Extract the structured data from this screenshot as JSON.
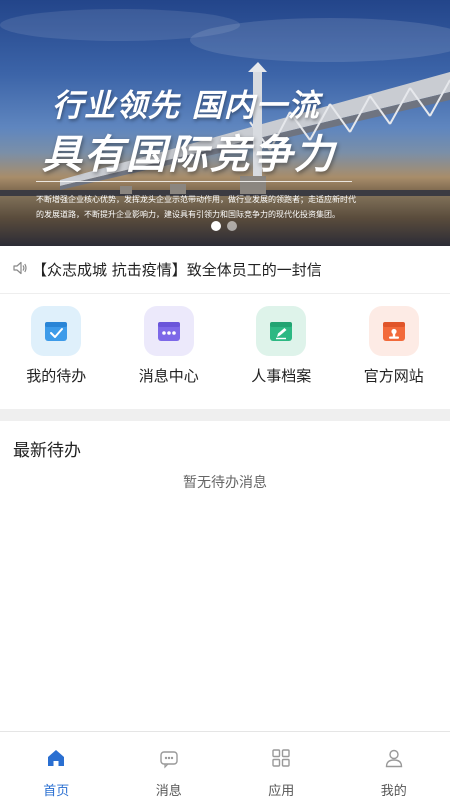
{
  "banner": {
    "headline_1": "行业领先  国内一流",
    "headline_2": "具有国际竞争力",
    "description": "不断增强企业核心优势，发挥龙头企业示范带动作用，做行业发展的领跑者；走适应新时代的发展道路，不断提升企业影响力，建设具有引领力和国际竞争力的现代化投资集团。",
    "slide_count": 2,
    "active_slide": 1
  },
  "notice": {
    "icon": "speaker-icon",
    "text": "【众志成城 抗击疫情】致全体员工的一封信"
  },
  "quick_actions": [
    {
      "label": "我的待办",
      "icon": "calendar-check-icon",
      "color": "#3d9be9"
    },
    {
      "label": "消息中心",
      "icon": "message-icon",
      "color": "#7d68e8"
    },
    {
      "label": "人事档案",
      "icon": "edit-document-icon",
      "color": "#2db883"
    },
    {
      "label": "官方网站",
      "icon": "website-stamp-icon",
      "color": "#f26a3b"
    }
  ],
  "todo": {
    "title": "最新待办",
    "empty_text": "暂无待办消息"
  },
  "tabbar": {
    "active": "home",
    "items": [
      {
        "label": "首页",
        "icon": "home-icon"
      },
      {
        "label": "消息",
        "icon": "message-icon"
      },
      {
        "label": "应用",
        "icon": "apps-grid-icon"
      },
      {
        "label": "我的",
        "icon": "user-icon"
      }
    ],
    "active_color": "#2a6fd1"
  }
}
